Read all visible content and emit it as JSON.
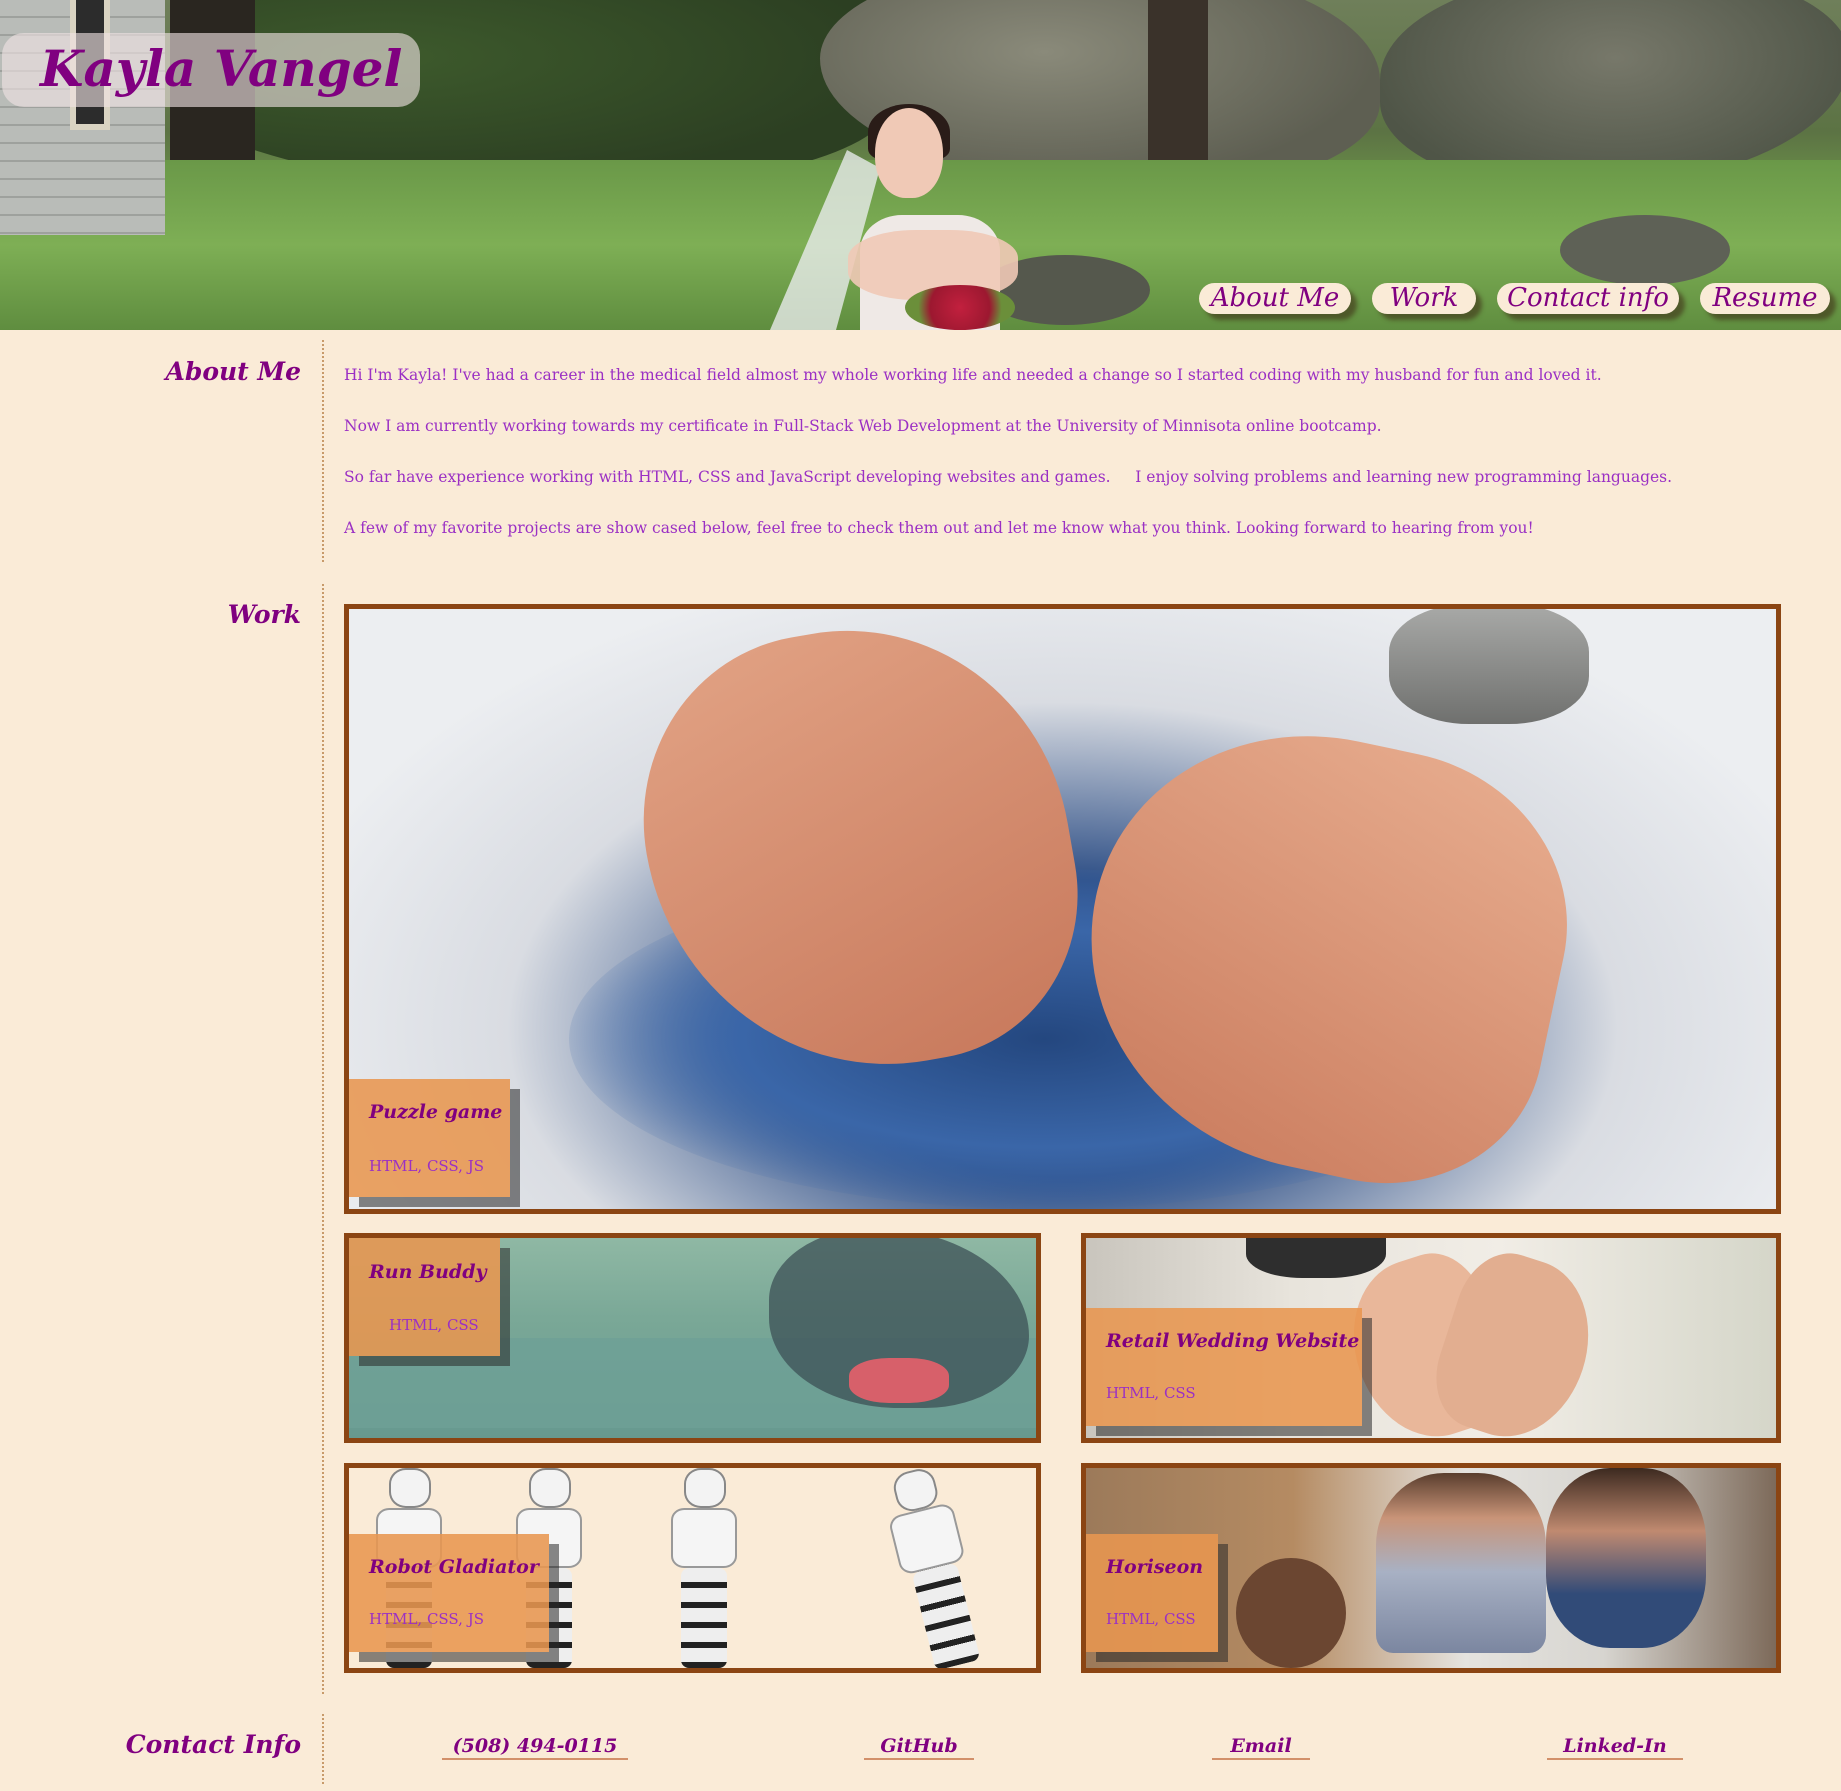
{
  "header": {
    "brand": "Kayla Vangel",
    "nav": [
      "About Me",
      "Work",
      "Contact info",
      "Resume"
    ]
  },
  "about": {
    "label": "About Me",
    "paragraphs": [
      "Hi I'm Kayla! I've had a career in the medical field almost my whole working life and needed a change so I started coding with my husband for fun and loved it.",
      "Now I am currently working towards my certificate in Full-Stack Web Development at the University of Minnisota online bootcamp.",
      "So far have experience working with HTML, CSS and JavaScript developing websites and games.     I enjoy solving problems and learning new programming languages.",
      "A few of my favorite projects are show cased below, feel free to check them out and let me know what you think. Looking forward to hearing from you!"
    ]
  },
  "work": {
    "label": "Work",
    "projects": [
      {
        "title": "Puzzle game",
        "tech": "HTML, CSS, JS"
      },
      {
        "title": "Run Buddy",
        "tech": "HTML, CSS"
      },
      {
        "title": "Retail Wedding Website",
        "tech": "HTML, CSS"
      },
      {
        "title": "Robot Gladiator",
        "tech": "HTML, CSS, JS"
      },
      {
        "title": "Horiseon",
        "tech": "HTML, CSS"
      }
    ]
  },
  "contact": {
    "label": "Contact Info",
    "links": [
      "(508) 494-0115",
      "GitHub",
      "Email",
      "Linked-In"
    ]
  },
  "colors": {
    "background": "#faebd7",
    "accent": "#800080",
    "body_text": "#9b30c4",
    "card_border": "#8b4513",
    "label_bg": "#e8964f"
  }
}
